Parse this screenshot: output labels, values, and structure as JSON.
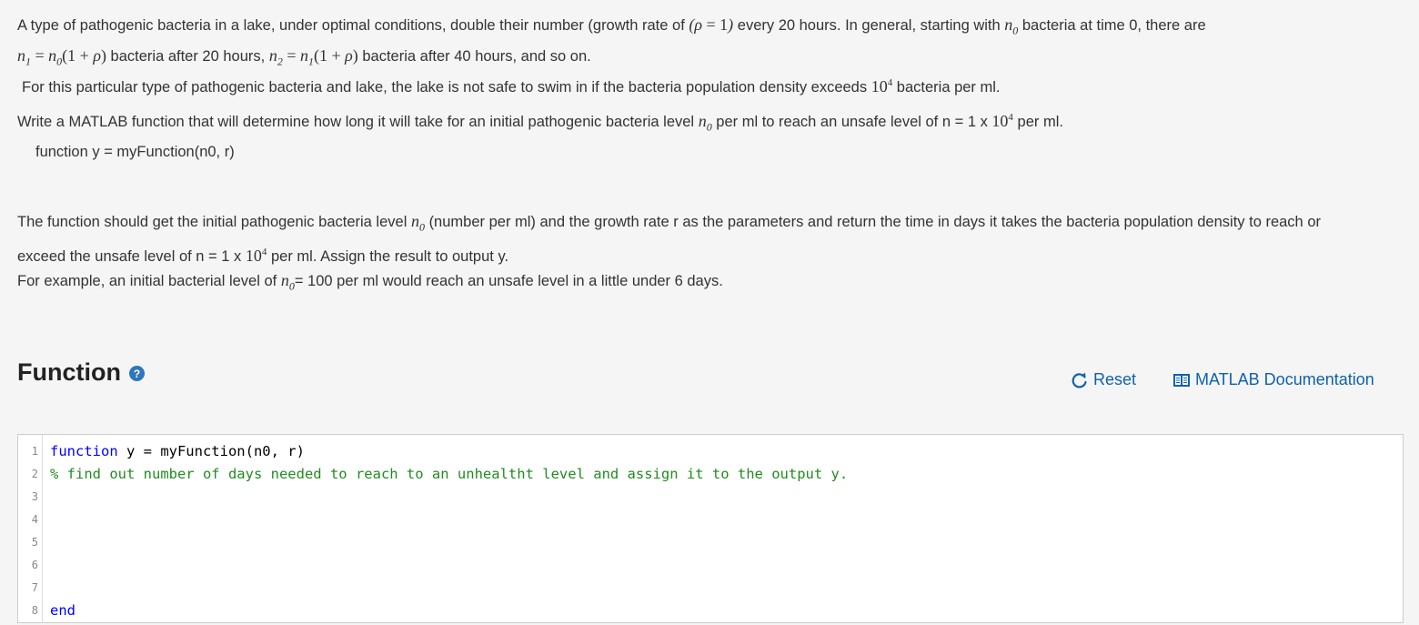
{
  "problem": {
    "p1_a": "A type of pathogenic bacteria in a lake, under optimal conditions, double their number (growth rate of",
    "p1_b": "every 20 hours. In general, starting with",
    "p1_c": "bacteria at time 0, there are",
    "p1_d": "bacteria after 20 hours,",
    "p1_e": "bacteria after 40 hours, and so on.",
    "p2_a": "For this particular type of pathogenic bacteria and lake, the lake is not safe to swim in if the bacteria population density exceeds",
    "p2_b": "bacteria per ml.",
    "p3_a": "Write a MATLAB function that will determine how long it will take for an initial pathogenic bacteria level",
    "p3_b": "per ml to reach an unsafe level of n = 1 x",
    "p3_c": "per ml.",
    "signature": "function y = myFunction(n0, r)",
    "p4_a": "The function should get the initial pathogenic bacteria level",
    "p4_b": "(number per ml) and the growth rate r as the parameters and return the time in days it takes the bacteria population density to reach or exceed the unsafe level of n = 1 x",
    "p4_c": "per ml. Assign the result to output y.",
    "p5_a": "For example, an initial bacterial level of",
    "p5_b": "= 100 per ml would reach an unsafe level in a little under 6 days."
  },
  "math": {
    "rho": "ρ",
    "eq": " = 1",
    "n": "n",
    "sub0": "0",
    "sub1": "1",
    "sub2": "2",
    "plus": "(1 + ",
    "equals": " = ",
    "close": ")",
    "ten": "10",
    "four": "4"
  },
  "section": {
    "title": "Function",
    "help_icon": "?"
  },
  "toolbar": {
    "reset_label": "Reset",
    "docs_label": "MATLAB Documentation",
    "reset_icon": "refresh-icon",
    "docs_icon": "book-icon"
  },
  "editor": {
    "lines": [
      {
        "num": "1",
        "kw": "function",
        "rest": " y = myFunction(n0, r)",
        "comment": ""
      },
      {
        "num": "2",
        "kw": "",
        "rest": "",
        "comment": "% find out number of days needed to reach to an unhealtht level and assign it to the output y."
      },
      {
        "num": "3",
        "kw": "",
        "rest": "",
        "comment": ""
      },
      {
        "num": "4",
        "kw": "",
        "rest": "",
        "comment": ""
      },
      {
        "num": "5",
        "kw": "",
        "rest": "",
        "comment": ""
      },
      {
        "num": "6",
        "kw": "",
        "rest": "",
        "comment": ""
      },
      {
        "num": "7",
        "kw": "",
        "rest": "",
        "comment": ""
      },
      {
        "num": "8",
        "kw": "end",
        "rest": "",
        "comment": ""
      }
    ],
    "colors": {
      "keyword": "#0000ff",
      "comment": "#228b22"
    }
  }
}
